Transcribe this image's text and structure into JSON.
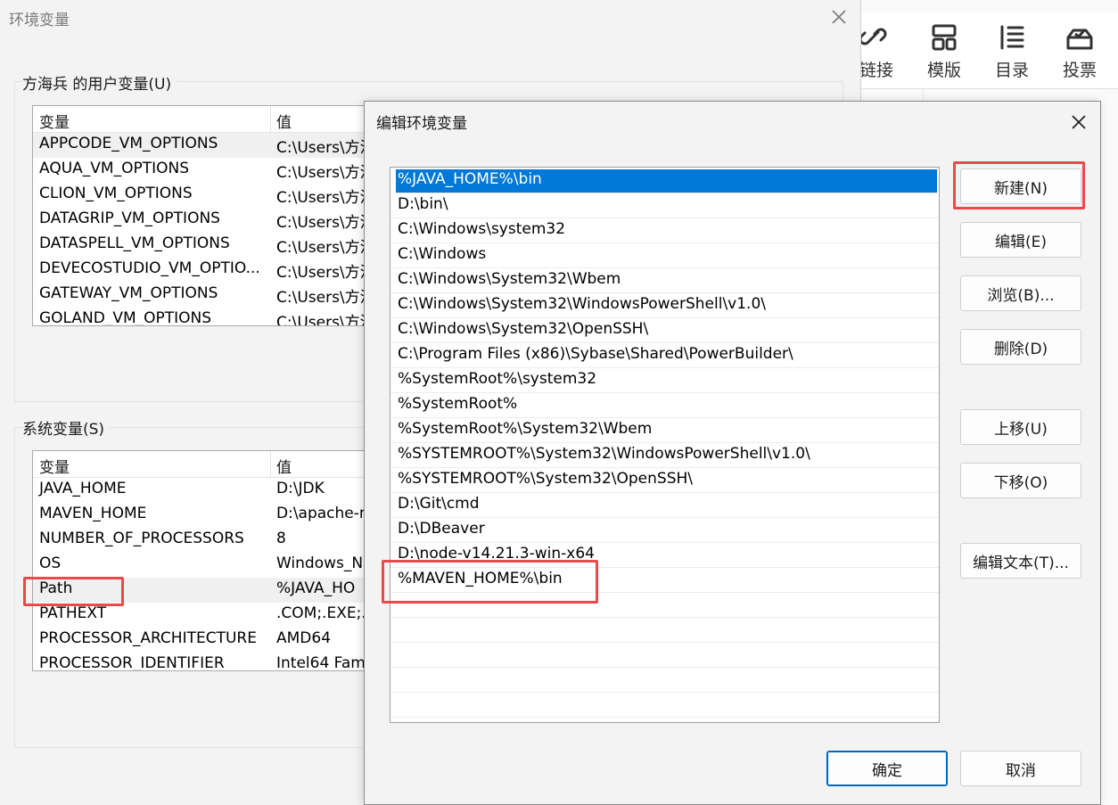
{
  "background_app": {
    "toolbar": [
      {
        "label": "链接",
        "icon": "link-icon"
      },
      {
        "label": "模版",
        "icon": "template-icon"
      },
      {
        "label": "目录",
        "icon": "list-icon"
      },
      {
        "label": "投票",
        "icon": "vote-icon"
      }
    ]
  },
  "env_window": {
    "title": "环境变量",
    "user_group_title": "方海兵 的用户变量(U)",
    "system_group_title": "系统变量(S)",
    "col_name": "变量",
    "col_value": "值",
    "user_vars": [
      {
        "name": "APPCODE_VM_OPTIONS",
        "value": "C:\\Users\\方注"
      },
      {
        "name": "AQUA_VM_OPTIONS",
        "value": "C:\\Users\\方注"
      },
      {
        "name": "CLION_VM_OPTIONS",
        "value": "C:\\Users\\方注"
      },
      {
        "name": "DATAGRIP_VM_OPTIONS",
        "value": "C:\\Users\\方注"
      },
      {
        "name": "DATASPELL_VM_OPTIONS",
        "value": "C:\\Users\\方注"
      },
      {
        "name": "DEVECOSTUDIO_VM_OPTIO...",
        "value": "C:\\Users\\方注"
      },
      {
        "name": "GATEWAY_VM_OPTIONS",
        "value": "C:\\Users\\方注"
      },
      {
        "name": "GOLAND_VM_OPTIONS",
        "value": "C:\\Users\\方注"
      }
    ],
    "system_vars": [
      {
        "name": "JAVA_HOME",
        "value": "D:\\JDK"
      },
      {
        "name": "MAVEN_HOME",
        "value": "D:\\apache-m"
      },
      {
        "name": "NUMBER_OF_PROCESSORS",
        "value": "8"
      },
      {
        "name": "OS",
        "value": "Windows_N"
      },
      {
        "name": "Path",
        "value": "%JAVA_HO"
      },
      {
        "name": "PATHEXT",
        "value": ".COM;.EXE;."
      },
      {
        "name": "PROCESSOR_ARCHITECTURE",
        "value": "AMD64"
      },
      {
        "name": "PROCESSOR_IDENTIFIER",
        "value": "Intel64 Fam"
      }
    ]
  },
  "edit_dialog": {
    "title": "编辑环境变量",
    "paths": [
      "%JAVA_HOME%\\bin",
      "D:\\bin\\",
      "C:\\Windows\\system32",
      "C:\\Windows",
      "C:\\Windows\\System32\\Wbem",
      "C:\\Windows\\System32\\WindowsPowerShell\\v1.0\\",
      "C:\\Windows\\System32\\OpenSSH\\",
      "C:\\Program Files (x86)\\Sybase\\Shared\\PowerBuilder\\",
      "%SystemRoot%\\system32",
      "%SystemRoot%",
      "%SystemRoot%\\System32\\Wbem",
      "%SYSTEMROOT%\\System32\\WindowsPowerShell\\v1.0\\",
      "%SYSTEMROOT%\\System32\\OpenSSH\\",
      "D:\\Git\\cmd",
      "D:\\DBeaver",
      "D:\\node-v14.21.3-win-x64",
      "%MAVEN_HOME%\\bin",
      "",
      "",
      "",
      "",
      ""
    ],
    "buttons": {
      "new": "新建(N)",
      "edit": "编辑(E)",
      "browse": "浏览(B)...",
      "delete": "删除(D)",
      "move_up": "上移(U)",
      "move_down": "下移(O)",
      "edit_text": "编辑文本(T)...",
      "ok": "确定",
      "cancel": "取消"
    }
  },
  "colors": {
    "selection": "#0078d7",
    "highlight_box": "#ea4a4a",
    "primary_border": "#0067c0"
  }
}
